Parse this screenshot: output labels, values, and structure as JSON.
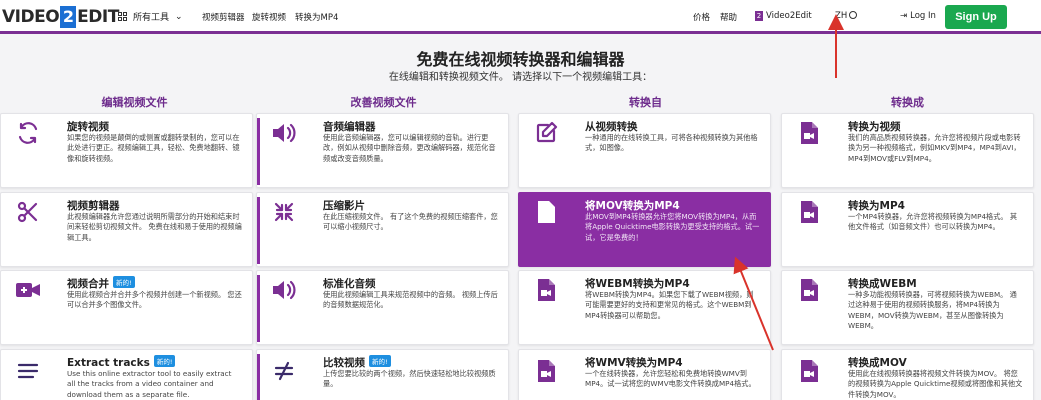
{
  "header": {
    "logo_left": "VIDEO",
    "logo_two": "2",
    "logo_right": "EDIT",
    "tools_menu": "所有工具",
    "links": [
      "视频剪辑器",
      "旋转视频",
      "转换为MP4"
    ],
    "pricing": "价格",
    "help": "帮助",
    "brand_link": "Video2Edit",
    "brand_sq": "2",
    "language": "ZH",
    "login": "Log In",
    "signup": "Sign Up"
  },
  "hero": {
    "title": "免费在线视频转换器和编辑器",
    "subtitle": "在线编辑和转换视频文件。 请选择以下一个视频编辑工具："
  },
  "columns": [
    {
      "heading": "编辑视频文件",
      "cards": [
        {
          "icon": "rotate-icon",
          "title": "旋转视频",
          "badge": "",
          "desc": "如果您的视频是颠倒的或侧置或翻转录制的，您可以在此处进行更正。视频编辑工具，轻松、免费地翻转、镜像和旋转视频。"
        },
        {
          "icon": "scissors-icon",
          "title": "视频剪辑器",
          "badge": "",
          "desc": "此视频编辑器允许您通过说明所需部分的开始和结束时间来轻松剪切视频文件。 免费在线和易于使用的视频编辑工具。"
        },
        {
          "icon": "camera-icon",
          "title": "视频合并",
          "badge": "新的!",
          "desc": "使用此视频合并合并多个视频并创建一个新视频。 您还可以合并多个图像文件。"
        },
        {
          "icon": "menu-icon",
          "title": "Extract tracks",
          "badge": "新的!",
          "desc": "Use this online extractor tool to easily extract all the tracks from a video container and download them as a separate file."
        }
      ]
    },
    {
      "heading": "改善视频文件",
      "cards": [
        {
          "icon": "volume-icon",
          "title": "音频编辑器",
          "badge": "",
          "desc": "使用此音频编辑器，您可以编辑视频的音轨。进行更改，例如从视频中删除音频，更改编解码器，规范化音频或改变音频质量。"
        },
        {
          "icon": "compress-icon",
          "title": "压缩影片",
          "badge": "",
          "desc": "在此压缩视频文件。 有了这个免费的视频压缩套件，您可以缩小视频尺寸。"
        },
        {
          "icon": "volume-icon",
          "title": "标准化音频",
          "badge": "",
          "desc": "使用此视频编辑工具来规范视频中的音频。 视频上传后的音频数据规范化。"
        },
        {
          "icon": "not-equal-icon",
          "title": "比较视频",
          "badge": "新的!",
          "desc": "上传您要比较的两个视频，然后快速轻松地比较视频质量。"
        }
      ]
    },
    {
      "heading": "转换自",
      "cards": [
        {
          "icon": "edit-icon",
          "title": "从视频转换",
          "badge": "",
          "desc": "一种通用的在线转换工具，可将各种视频转换为其他格式，如图像。"
        },
        {
          "icon": "video-file-icon",
          "title": "将MOV转换为MP4",
          "badge": "",
          "desc": "此MOV到MP4转换器允许您将MOV转换为MP4，从而将Apple Quicktime电影转换为更受支持的格式。试一试，它是免费的！",
          "selected": true
        },
        {
          "icon": "video-file-icon",
          "title": "将WEBM转换为MP4",
          "badge": "",
          "desc": "将WEBM转换为MP4。如果您下载了WEBM视频，则可能需要更好的支持和更常见的格式。这个WEBM到MP4转换器可以帮助您。"
        },
        {
          "icon": "video-file-icon",
          "title": "将WMV转换为MP4",
          "badge": "",
          "desc": "一个在线转换器，允许您轻松和免费地转换WMV到MP4。试一试将您的WMV电影文件转换成MP4格式。"
        }
      ]
    },
    {
      "heading": "转换成",
      "cards": [
        {
          "icon": "video-file-icon",
          "title": "转换为视频",
          "badge": "",
          "desc": "我们的高品质视频转换器，允许您将视频片段或电影转换为另一种视频格式，例如MKV到MP4，MP4到AVI，MP4到MOV或FLV到MP4。"
        },
        {
          "icon": "video-file-icon",
          "title": "转换为MP4",
          "badge": "",
          "desc": "一个MP4转换器，允许您将视频转换为MP4格式。 其他文件格式（如音频文件）也可以转换为MP4。"
        },
        {
          "icon": "video-file-icon",
          "title": "转换成WEBM",
          "badge": "",
          "desc": "一种多功能视频转换器，可将视频转换为WEBM。 通过这种易于使用的视频转换服务，将MP4转换为WEBM，MOV转换为WEBM，甚至从图像转换为WEBM。"
        },
        {
          "icon": "video-file-icon",
          "title": "转换成MOV",
          "badge": "",
          "desc": "使用此在线视频转换器将视频文件转换为MOV。 将您的视频转换为Apple Quicktime视频或将图像和其他文件转换为MOV。"
        }
      ]
    }
  ],
  "colors": {
    "accent": "#8a2ea3",
    "signup": "#1aa84f",
    "badge": "#1e8fe0",
    "annotation": "#d9332b"
  }
}
